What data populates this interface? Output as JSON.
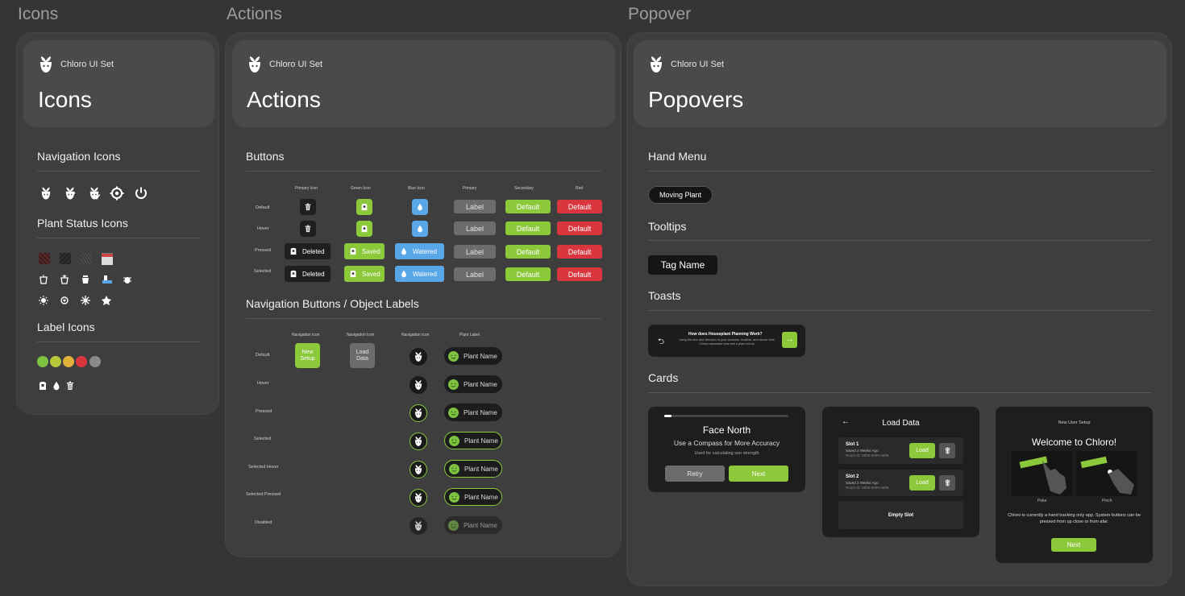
{
  "sections": {
    "icons": "Icons",
    "actions": "Actions",
    "popover": "Popover"
  },
  "brand": "Chloro UI Set",
  "icons_panel": {
    "title": "Icons",
    "nav_icons": "Navigation Icons",
    "plant_status": "Plant Status Icons",
    "label_icons": "Label Icons"
  },
  "actions_panel": {
    "title": "Actions",
    "buttons": "Buttons",
    "col_headers": [
      "Primary Icon",
      "Green Icon",
      "Blue Icon",
      "Primary",
      "Secondary",
      "Red"
    ],
    "row_headers": [
      "Default",
      "Hover",
      "Pressed",
      "Selected"
    ],
    "label": "Label",
    "default": "Default",
    "deleted": "Deleted",
    "saved": "Saved",
    "watered": "Watered",
    "nav_title": "Navigation Buttons / Object Labels",
    "nav_col_headers": [
      "Navigation Icon",
      "Navigation Icon",
      "Navigation Icon",
      "Plant Label"
    ],
    "nav_rows": [
      "Default",
      "Hover",
      "Pressed",
      "Selected",
      "Selected Hover",
      "Selected Pressed",
      "Disabled"
    ],
    "new_setup": "New Setup",
    "load_data": "Load Data",
    "plant_name": "Plant Name"
  },
  "popover_panel": {
    "title": "Popovers",
    "hand_menu": "Hand Menu",
    "moving_plant": "Moving Plant",
    "tooltips": "Tooltips",
    "tag_name": "Tag Name",
    "toasts": "Toasts",
    "toast_title": "How does Houseplant Planning Work?",
    "toast_body": "Using the size and direction of your windows, location, and device time, Chloro calculates how well a plant will do.",
    "cards": "Cards",
    "card1": {
      "title": "Face North",
      "subtitle": "Use a Compass for More Accuracy",
      "note": "Used for calculating sun strength",
      "retry": "Retry",
      "next": "Next",
      "progress": 0.06
    },
    "card2": {
      "title": "Load Data",
      "slots": [
        {
          "name": "Slot 1",
          "saved": "Saved 2 Weeks Ago",
          "room": "Room ID: 0000-0000-0000",
          "load": "Load"
        },
        {
          "name": "Slot 2",
          "saved": "Saved 2 Weeks Ago",
          "room": "Room ID: 0000-0000-0000",
          "load": "Load"
        }
      ],
      "empty": "Empty Slot"
    },
    "card3": {
      "header": "New User Setup",
      "title": "Welcome to Chloro!",
      "poke": "Poke",
      "pinch": "Pinch",
      "body": "Chloro is currently a hand tracking only app. System buttons can be pressed from up close or from afar.",
      "next": "Next"
    }
  },
  "colors": {
    "green": "#8bc83a",
    "blue": "#5aa7e8",
    "red": "#d9363e",
    "panel": "#3e3e3e"
  }
}
